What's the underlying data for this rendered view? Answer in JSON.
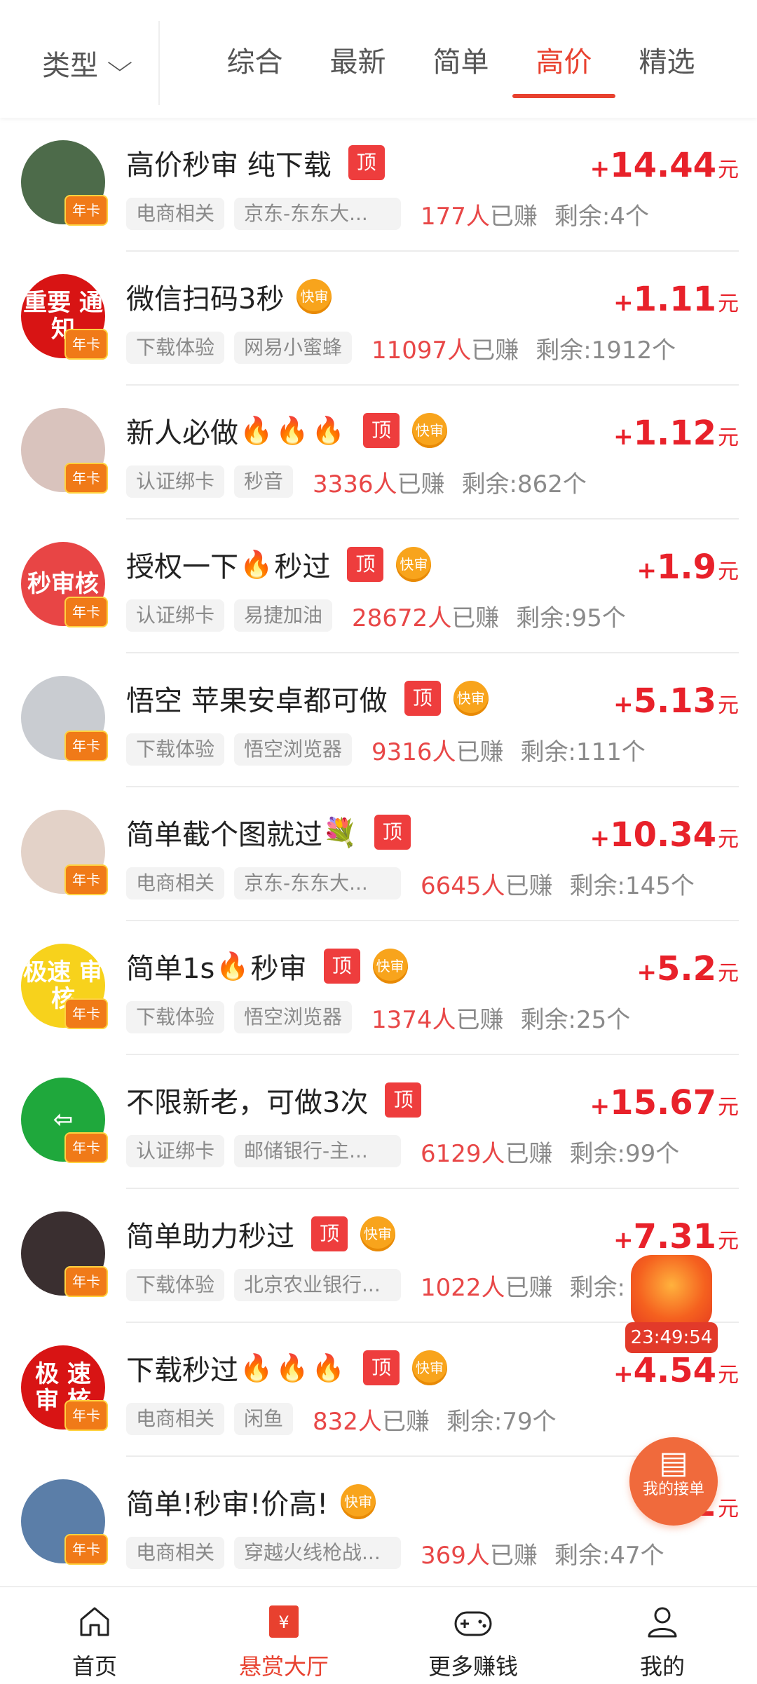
{
  "filter": {
    "type_label": "类型",
    "tabs": [
      {
        "label": "综合",
        "active": false
      },
      {
        "label": "最新",
        "active": false
      },
      {
        "label": "简单",
        "active": false
      },
      {
        "label": "高价",
        "active": true
      },
      {
        "label": "精选",
        "active": false
      }
    ]
  },
  "tasks": [
    {
      "title": "高价秒审 纯下载",
      "fires": 0,
      "fires_mid": false,
      "title_tail": "",
      "badge_top": true,
      "badge_fast": false,
      "tag1": "电商相关",
      "tag2": "京东-东东大...",
      "earned": "177人",
      "earned_suffix": "已赚",
      "remaining": "剩余:4个",
      "plus": "+",
      "price": "14.44",
      "unit": "元",
      "avatar_text": "",
      "avatar_color": "#4d6b4a"
    },
    {
      "title": "微信扫码3秒",
      "fires": 0,
      "fires_mid": false,
      "title_tail": "",
      "badge_top": false,
      "badge_fast": true,
      "tag1": "下载体验",
      "tag2": "网易小蜜蜂",
      "earned": "11097人",
      "earned_suffix": "已赚",
      "remaining": "剩余:1912个",
      "plus": "+",
      "price": "1.11",
      "unit": "元",
      "avatar_text": "重要 通知",
      "avatar_color": "#d81414"
    },
    {
      "title": "新人必做",
      "fires": 3,
      "fires_mid": false,
      "title_tail": "",
      "badge_top": true,
      "badge_fast": true,
      "tag1": "认证绑卡",
      "tag2": "秒音",
      "earned": "3336人",
      "earned_suffix": "已赚",
      "remaining": "剩余:862个",
      "plus": "+",
      "price": "1.12",
      "unit": "元",
      "avatar_text": "",
      "avatar_color": "#d9c3bd"
    },
    {
      "title": "授权一下",
      "fires": 1,
      "fires_mid": true,
      "title_tail": "秒过",
      "badge_top": true,
      "badge_fast": true,
      "tag1": "认证绑卡",
      "tag2": "易捷加油",
      "earned": "28672人",
      "earned_suffix": "已赚",
      "remaining": "剩余:95个",
      "plus": "+",
      "price": "1.9",
      "unit": "元",
      "avatar_text": "秒审核",
      "avatar_color": "#e84545"
    },
    {
      "title": "悟空 苹果安卓都可做",
      "fires": 0,
      "fires_mid": false,
      "title_tail": "",
      "badge_top": true,
      "badge_fast": true,
      "tag1": "下载体验",
      "tag2": "悟空浏览器",
      "earned": "9316人",
      "earned_suffix": "已赚",
      "remaining": "剩余:111个",
      "plus": "+",
      "price": "5.13",
      "unit": "元",
      "avatar_text": "",
      "avatar_color": "#c9ccd1"
    },
    {
      "title": "简单截个图就过",
      "fires": 0,
      "fires_mid": false,
      "title_tail": "💐",
      "badge_top": true,
      "badge_fast": false,
      "tag1": "电商相关",
      "tag2": "京东-东东大...",
      "earned": "6645人",
      "earned_suffix": "已赚",
      "remaining": "剩余:145个",
      "plus": "+",
      "price": "10.34",
      "unit": "元",
      "avatar_text": "",
      "avatar_color": "#e3d2c8"
    },
    {
      "title": "简单1s",
      "fires": 1,
      "fires_mid": true,
      "title_tail": "秒审",
      "badge_top": true,
      "badge_fast": true,
      "tag1": "下载体验",
      "tag2": "悟空浏览器",
      "earned": "1374人",
      "earned_suffix": "已赚",
      "remaining": "剩余:25个",
      "plus": "+",
      "price": "5.2",
      "unit": "元",
      "avatar_text": "极速 审核",
      "avatar_color": "#f7d21c"
    },
    {
      "title": "不限新老，可做3次",
      "fires": 0,
      "fires_mid": false,
      "title_tail": "",
      "badge_top": true,
      "badge_fast": false,
      "tag1": "认证绑卡",
      "tag2": "邮储银行-主...",
      "earned": "6129人",
      "earned_suffix": "已赚",
      "remaining": "剩余:99个",
      "plus": "+",
      "price": "15.67",
      "unit": "元",
      "avatar_text": "⇦",
      "avatar_color": "#1fa83c"
    },
    {
      "title": "简单助力秒过",
      "fires": 0,
      "fires_mid": false,
      "title_tail": "",
      "badge_top": true,
      "badge_fast": true,
      "tag1": "下载体验",
      "tag2": "北京农业银行...",
      "earned": "1022人",
      "earned_suffix": "已赚",
      "remaining": "剩余:",
      "plus": "+",
      "price": "7.31",
      "unit": "元",
      "avatar_text": "",
      "avatar_color": "#3a2f30"
    },
    {
      "title": "下载秒过",
      "fires": 3,
      "fires_mid": false,
      "title_tail": "",
      "badge_top": true,
      "badge_fast": true,
      "tag1": "电商相关",
      "tag2": "闲鱼",
      "earned": "832人",
      "earned_suffix": "已赚",
      "remaining": "剩余:79个",
      "plus": "+",
      "price": "4.54",
      "unit": "元",
      "avatar_text": "极 速 审 核",
      "avatar_color": "#d81414"
    },
    {
      "title": "简单!秒审!价高!",
      "fires": 0,
      "fires_mid": false,
      "title_tail": "",
      "badge_top": false,
      "badge_fast": true,
      "tag1": "电商相关",
      "tag2": "穿越火线枪战...",
      "earned": "369人",
      "earned_suffix": "已赚",
      "remaining": "剩余:47个",
      "plus": "",
      "price": "2",
      "unit": "元",
      "avatar_text": "",
      "avatar_color": "#5b7ea8"
    }
  ],
  "badges": {
    "top": "顶",
    "fast": "快审",
    "year_card": "年卡"
  },
  "fire_glyph": "🔥",
  "floating": {
    "timer": "23:49:54",
    "my_orders": "我的接单"
  },
  "nav": [
    {
      "label": "首页",
      "icon": "home-icon",
      "active": false
    },
    {
      "label": "悬赏大厅",
      "icon": "reward-hall-icon",
      "active": true
    },
    {
      "label": "更多赚钱",
      "icon": "gamepad-icon",
      "active": false
    },
    {
      "label": "我的",
      "icon": "profile-icon",
      "active": false
    }
  ],
  "colors": {
    "accent": "#e8412f",
    "price": "#e8212a",
    "fast_badge": "#f8a41c"
  }
}
